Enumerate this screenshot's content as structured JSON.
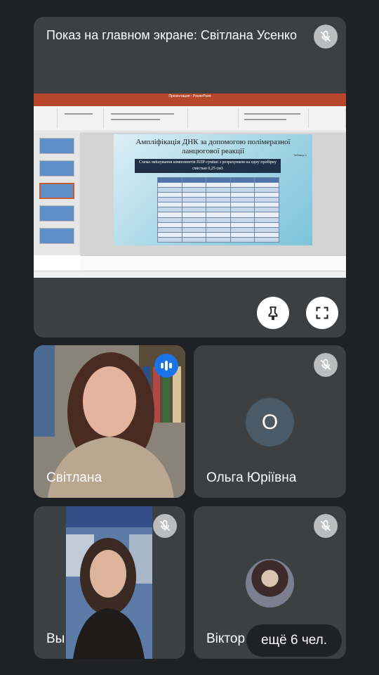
{
  "presentation": {
    "title": "Показ на главном экране: Світлана Усенко",
    "slide": {
      "heading": "Ампліфікація ДНК за допомогою полімеразної ланцюгової реакції",
      "table_caption": "Таблиця 1",
      "subtitle": "Схема змішування компонентів ПЛР-суміші з розрахунком на одну пробірку смістью 0,25 см3",
      "ppt_window_title": "Презентация - PowerPoint"
    },
    "pin_icon": "pin-icon",
    "fullscreen_icon": "fullscreen-icon"
  },
  "participants": [
    {
      "name": "Світлана",
      "speaking": true
    },
    {
      "name": "Ольга Юріївна",
      "avatar_letter": "О",
      "muted": true
    },
    {
      "name": "Вы",
      "muted": true
    },
    {
      "name": "Віктор",
      "muted": true
    }
  ],
  "more": {
    "label": "ещё 6 чел."
  },
  "colors": {
    "background": "#202124",
    "tile": "#3c4043",
    "speaking": "#1a73e8"
  }
}
